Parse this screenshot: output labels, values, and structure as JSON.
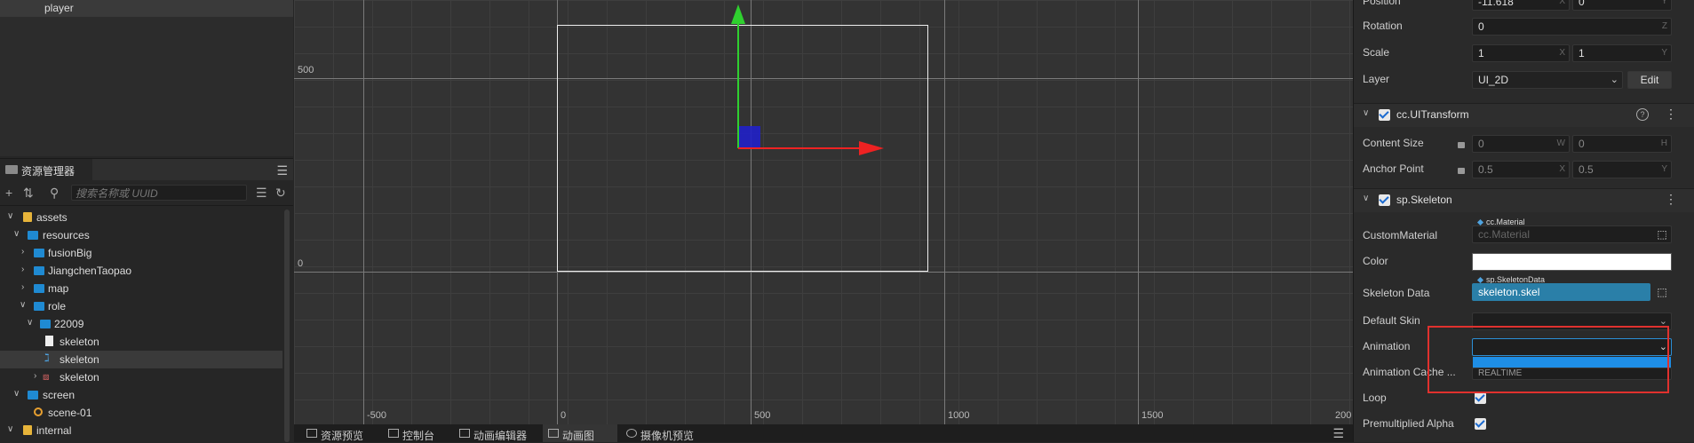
{
  "hierarchy": {
    "selected_node": "player"
  },
  "assets": {
    "tab_label": "资源管理器",
    "search_placeholder": "搜索名称或 UUID",
    "tree": [
      {
        "label": "assets"
      },
      {
        "label": "resources"
      },
      {
        "label": "fusionBig"
      },
      {
        "label": "JiangchenTaopao"
      },
      {
        "label": "map"
      },
      {
        "label": "role"
      },
      {
        "label": "22009"
      },
      {
        "label": "skeleton"
      },
      {
        "label": "skeleton"
      },
      {
        "label": "skeleton"
      },
      {
        "label": "screen"
      },
      {
        "label": "scene-01"
      },
      {
        "label": "internal"
      }
    ]
  },
  "scene": {
    "y_labels": [
      "500",
      "0"
    ],
    "x_labels": [
      "-500",
      "0",
      "500",
      "1000",
      "1500",
      "200"
    ]
  },
  "bottom_tabs": [
    {
      "label": "资源预览"
    },
    {
      "label": "控制台"
    },
    {
      "label": "动画编辑器"
    },
    {
      "label": "动画图"
    },
    {
      "label": "摄像机预览"
    }
  ],
  "inspector": {
    "position": {
      "label": "Position",
      "x": "-11.618",
      "y": "0"
    },
    "rotation": {
      "label": "Rotation",
      "value": "0",
      "axis": "Z"
    },
    "scale": {
      "label": "Scale",
      "x": "1",
      "y": "1"
    },
    "layer": {
      "label": "Layer",
      "value": "UI_2D",
      "edit": "Edit"
    },
    "uitransform": {
      "title": "cc.UITransform",
      "content_size": {
        "label": "Content Size",
        "w": "0",
        "h": "0"
      },
      "anchor_point": {
        "label": "Anchor Point",
        "x": "0.5",
        "y": "0.5"
      }
    },
    "skeleton": {
      "title": "sp.Skeleton",
      "custom_material": {
        "label": "CustomMaterial",
        "tag": "cc.Material",
        "value": "cc.Material"
      },
      "color": {
        "label": "Color",
        "value": "#ffffff"
      },
      "skeleton_data": {
        "label": "Skeleton Data",
        "tag": "sp.SkeletonData",
        "value": "skeleton.skel"
      },
      "default_skin": {
        "label": "Default Skin",
        "value": ""
      },
      "animation": {
        "label": "Animation",
        "value": ""
      },
      "animation_cache": {
        "label": "Animation Cache ...",
        "value": "REALTIME"
      },
      "loop": {
        "label": "Loop",
        "checked": true
      },
      "premultiplied": {
        "label": "Premultiplied Alpha",
        "checked": true
      }
    }
  },
  "colors": {
    "accent": "#1f8ad2",
    "highlight": "#e0312e"
  }
}
